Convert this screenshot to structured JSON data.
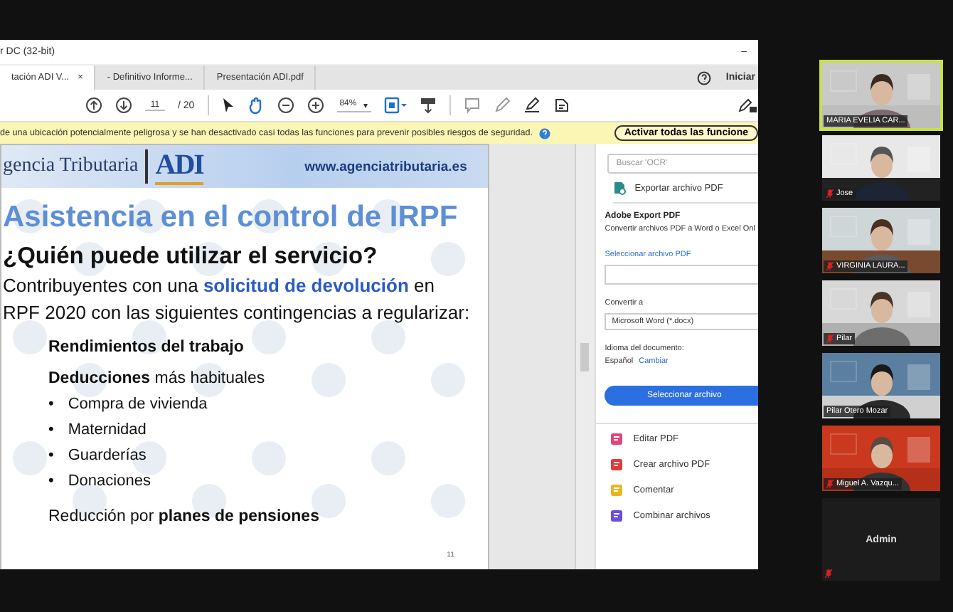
{
  "window": {
    "title": "r DC (32-bit)",
    "minimize": "–"
  },
  "tabs": [
    {
      "label": "tación ADI V...",
      "selected": true,
      "close": "×"
    },
    {
      "label": "- Definitivo Informe...",
      "selected": false
    },
    {
      "label": "Presentación ADI.pdf",
      "selected": false
    }
  ],
  "account": {
    "label": "Iniciar"
  },
  "toolbar": {
    "page": "11",
    "total": "/ 20",
    "zoom": "84%",
    "zoom_caret": "▾"
  },
  "security_bar": {
    "message": "de una ubicación potencialmente peligrosa y se han desactivado casi todas las funciones para prevenir posibles riesgos de seguridad.",
    "button": "Activar todas las funcione"
  },
  "slide": {
    "org": "gencia Tributaria",
    "logo": "ADI",
    "url": "www.agenciatributaria.es",
    "title": "Asistencia en el control de IRPF",
    "subtitle": "¿Quién puede utilizar el servicio?",
    "intro": [
      "Contribuyentes con una **solicitud de devolución** en",
      "RPF 2020 con las siguientes contingencias a regularizar:"
    ],
    "lines": [
      {
        "kind": "heading",
        "text": "Rendimientos del trabajo"
      },
      {
        "kind": "heading",
        "text": "**Deducciones** más habituales"
      },
      {
        "kind": "bullet",
        "mark": "•",
        "text": "Compra de vivienda"
      },
      {
        "kind": "bullet",
        "mark": "•",
        "text": "Maternidad"
      },
      {
        "kind": "bullet",
        "mark": "•",
        "text": "Guarderías"
      },
      {
        "kind": "bullet",
        "mark": "•",
        "text": "Donaciones"
      },
      {
        "kind": "closing",
        "text": "Reducción por **planes de pensiones**"
      }
    ],
    "page_number": "11"
  },
  "panel": {
    "search": {
      "placeholder": "Buscar 'OCR'"
    },
    "export": "Exportar archivo PDF",
    "heading": "Adobe Export PDF",
    "description": "Convertir archivos PDF a Word o Excel Onl",
    "select_link": "Seleccionar archivo PDF",
    "convert_label": "Convertir a",
    "format": "Microsoft Word (*.docx)",
    "language_label": "Idioma del documento:",
    "language": "Español",
    "change": "Cambiar",
    "button": "Seleccionar archivo",
    "tools": [
      {
        "label": "Editar PDF",
        "color": "#e0457b"
      },
      {
        "label": "Crear archivo PDF",
        "color": "#e03a3a"
      },
      {
        "label": "Comentar",
        "color": "#e8b820"
      },
      {
        "label": "Combinar archivos",
        "color": "#6a4fd8"
      }
    ]
  },
  "participants": [
    {
      "name": "MARIA EVELIA CAR...",
      "selected": true,
      "muted": false,
      "kind": "video"
    },
    {
      "name": "Jose",
      "selected": false,
      "muted": true,
      "kind": "video"
    },
    {
      "name": "VIRGINIA LAURA...",
      "selected": false,
      "muted": true,
      "kind": "video"
    },
    {
      "name": "Pilar",
      "selected": false,
      "muted": true,
      "kind": "video"
    },
    {
      "name": "Pilar Otero Mozar",
      "selected": false,
      "muted": false,
      "kind": "video"
    },
    {
      "name": "Miguel A. Vazqu...",
      "selected": false,
      "muted": true,
      "kind": "video"
    },
    {
      "name": "Admin",
      "selected": false,
      "muted": true,
      "kind": "avatar"
    }
  ]
}
